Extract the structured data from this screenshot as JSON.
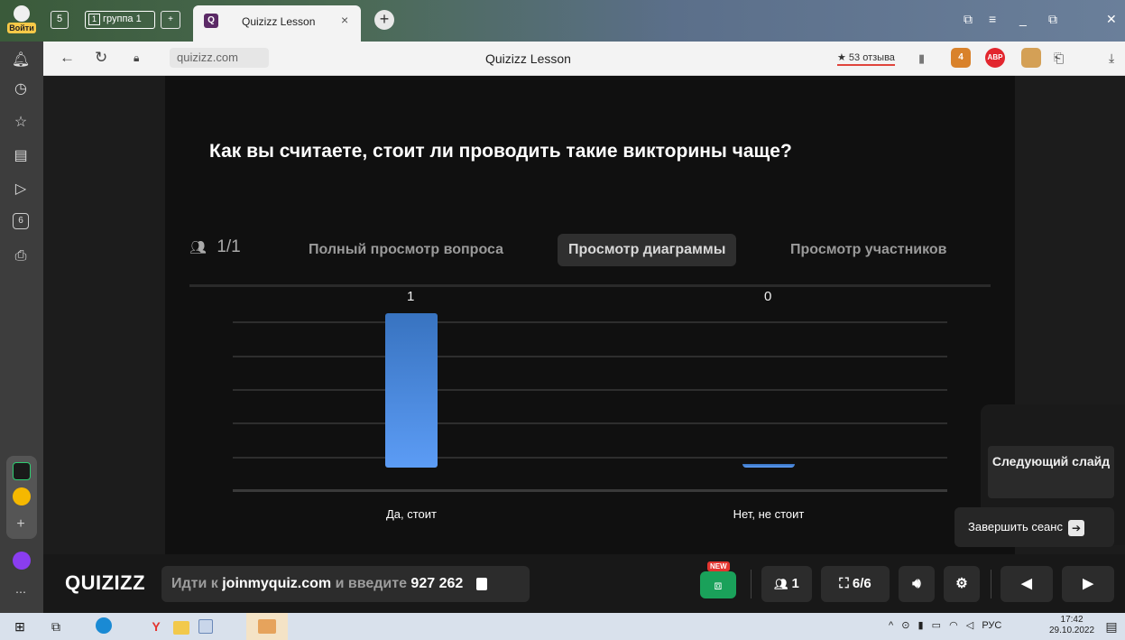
{
  "browser": {
    "login_label": "Войти",
    "tabs": [
      {
        "label": "5"
      },
      {
        "label": "группа 1",
        "number": "1"
      },
      {
        "label": "Quizizz Lesson",
        "favicon": "Q"
      }
    ],
    "url": "quizizz.com",
    "page_title": "Quizizz Lesson",
    "reviews": "★ 53 отзыва",
    "ext_abp": "ABP",
    "ext_badge": "4"
  },
  "sidebar": {
    "icons": [
      "bell-icon",
      "history-icon",
      "star-icon",
      "notes-icon",
      "play-icon",
      "calendar-icon",
      "screenshot-icon",
      "app-icon",
      "mail-icon",
      "add-icon",
      "alice-icon",
      "more-icon"
    ],
    "calendar_day": "6",
    "more": "⋯"
  },
  "quiz": {
    "question": "Как вы считаете, стоит ли проводить такие викторины чаще?",
    "participants": "1/1",
    "view_tabs": [
      "Полный просмотр вопроса",
      "Просмотр диаграммы",
      "Просмотр участников"
    ],
    "active_tab": 1
  },
  "chart_data": {
    "type": "bar",
    "categories": [
      "Да, стоит",
      "Нет, не стоит"
    ],
    "values": [
      1,
      0
    ],
    "ylim": [
      0,
      1
    ],
    "grid": true,
    "colors": [
      "#5c9cf5"
    ]
  },
  "controls": {
    "next_slide": "Следующий слайд",
    "end_session": "Завершить сеанс",
    "logo": "QUIZIZZ",
    "join_prefix": "Идти к",
    "join_site": "joinmyquiz.com",
    "join_mid": "и введите",
    "join_code": "927 262",
    "new_badge": "NEW",
    "participants_count": "1",
    "slides": "6/6"
  },
  "taskbar": {
    "lang": "РУС",
    "time": "17:42",
    "date": "29.10.2022"
  }
}
